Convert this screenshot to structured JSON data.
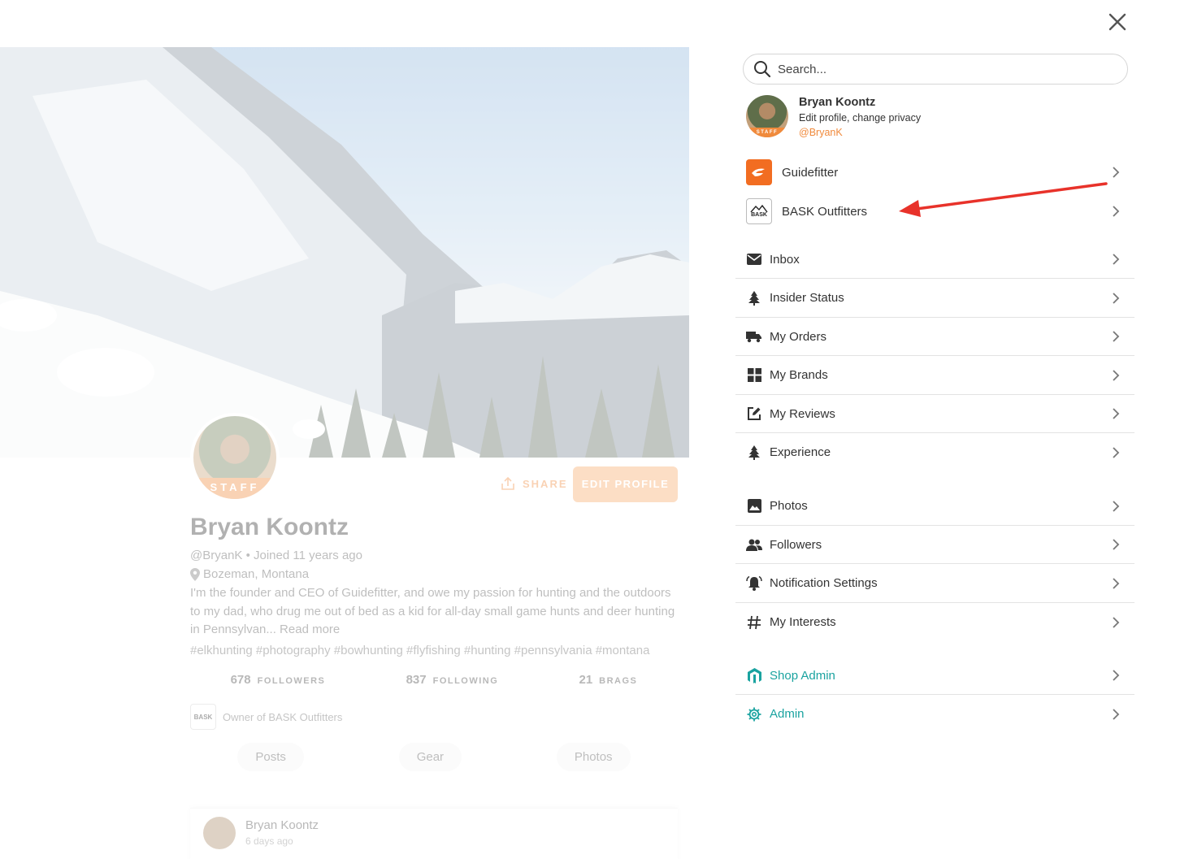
{
  "profile_bg": {
    "avatar_badge": "STAFF",
    "share_label": "SHARE",
    "edit_profile_label": "EDIT PROFILE",
    "name": "Bryan Koontz",
    "handle_joined": "@BryanK • Joined 11 years ago",
    "location": "Bozeman, Montana",
    "bio": "I'm the founder and CEO of Guidefitter, and owe my passion for hunting and the outdoors to my dad, who drug me out of bed as a kid for all-day small game hunts and deer hunting in Pennsylvan... Read more",
    "tags": "#elkhunting #photography #bowhunting #flyfishing #hunting #pennsylvania #montana",
    "stats": [
      {
        "num": "678",
        "label": "FOLLOWERS"
      },
      {
        "num": "837",
        "label": "FOLLOWING"
      },
      {
        "num": "21",
        "label": "BRAGS"
      }
    ],
    "owner_logo_text": "BASK",
    "owner_text": "Owner of BASK Outfitters",
    "tabs": [
      "Posts",
      "Gear",
      "Photos"
    ],
    "post": {
      "author": "Bryan Koontz",
      "time": "6 days ago"
    }
  },
  "drawer": {
    "search_placeholder": "Search...",
    "user": {
      "badge": "STAFF",
      "name": "Bryan Koontz",
      "subtitle": "Edit profile, change privacy",
      "handle": "@BryanK"
    },
    "accounts": [
      {
        "label": "Guidefitter",
        "icon": "guidefitter-logo-icon"
      },
      {
        "label": "BASK Outfitters",
        "icon": "bask-logo-icon",
        "logo_text": "BASK"
      }
    ],
    "menu_group_1": [
      {
        "label": "Inbox",
        "icon": "envelope-icon"
      },
      {
        "label": "Insider Status",
        "icon": "tree-icon"
      },
      {
        "label": "My Orders",
        "icon": "truck-icon"
      },
      {
        "label": "My Brands",
        "icon": "grid-icon"
      },
      {
        "label": "My Reviews",
        "icon": "edit-icon"
      },
      {
        "label": "Experience",
        "icon": "tree-icon"
      }
    ],
    "menu_group_2": [
      {
        "label": "Photos",
        "icon": "image-icon"
      },
      {
        "label": "Followers",
        "icon": "users-icon"
      },
      {
        "label": "Notification Settings",
        "icon": "bell-icon"
      },
      {
        "label": "My Interests",
        "icon": "hashtag-icon"
      }
    ],
    "menu_group_3": [
      {
        "label": "Shop Admin",
        "icon": "magento-icon"
      },
      {
        "label": "Admin",
        "icon": "gear-icon"
      }
    ]
  },
  "colors": {
    "accent_orange": "#f08a3c",
    "teal": "#1aa3a0",
    "annotation_red": "#e8322a"
  }
}
